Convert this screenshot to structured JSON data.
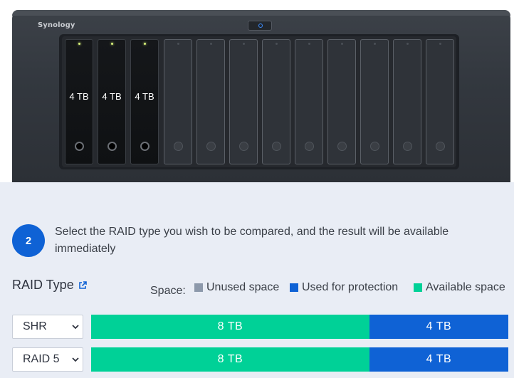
{
  "device": {
    "brand": "Synology",
    "bays": [
      {
        "filled": true,
        "label": "4 TB"
      },
      {
        "filled": true,
        "label": "4 TB"
      },
      {
        "filled": true,
        "label": "4 TB"
      },
      {
        "filled": false,
        "label": ""
      },
      {
        "filled": false,
        "label": ""
      },
      {
        "filled": false,
        "label": ""
      },
      {
        "filled": false,
        "label": ""
      },
      {
        "filled": false,
        "label": ""
      },
      {
        "filled": false,
        "label": ""
      },
      {
        "filled": false,
        "label": ""
      },
      {
        "filled": false,
        "label": ""
      },
      {
        "filled": false,
        "label": ""
      }
    ]
  },
  "step": {
    "number": "2",
    "text": "Select the RAID type you wish to be compared, and the result will be available immediately"
  },
  "raid": {
    "title": "RAID Type",
    "space_label": "Space:",
    "legend": [
      {
        "label": "Unused space",
        "color": "#8d99ab"
      },
      {
        "label": "Used for protection",
        "color": "#0f62d5"
      },
      {
        "label": "Available space",
        "color": "#00d197"
      }
    ],
    "rows": [
      {
        "type": "SHR",
        "available_pct": 66.7,
        "available": "8 TB",
        "protection": "4 TB"
      },
      {
        "type": "RAID 5",
        "available_pct": 66.7,
        "available": "8 TB",
        "protection": "4 TB"
      }
    ]
  },
  "colors": {
    "accent": "#0f62d5",
    "available": "#00d197",
    "protection": "#0f62d5",
    "unused": "#8d99ab"
  }
}
